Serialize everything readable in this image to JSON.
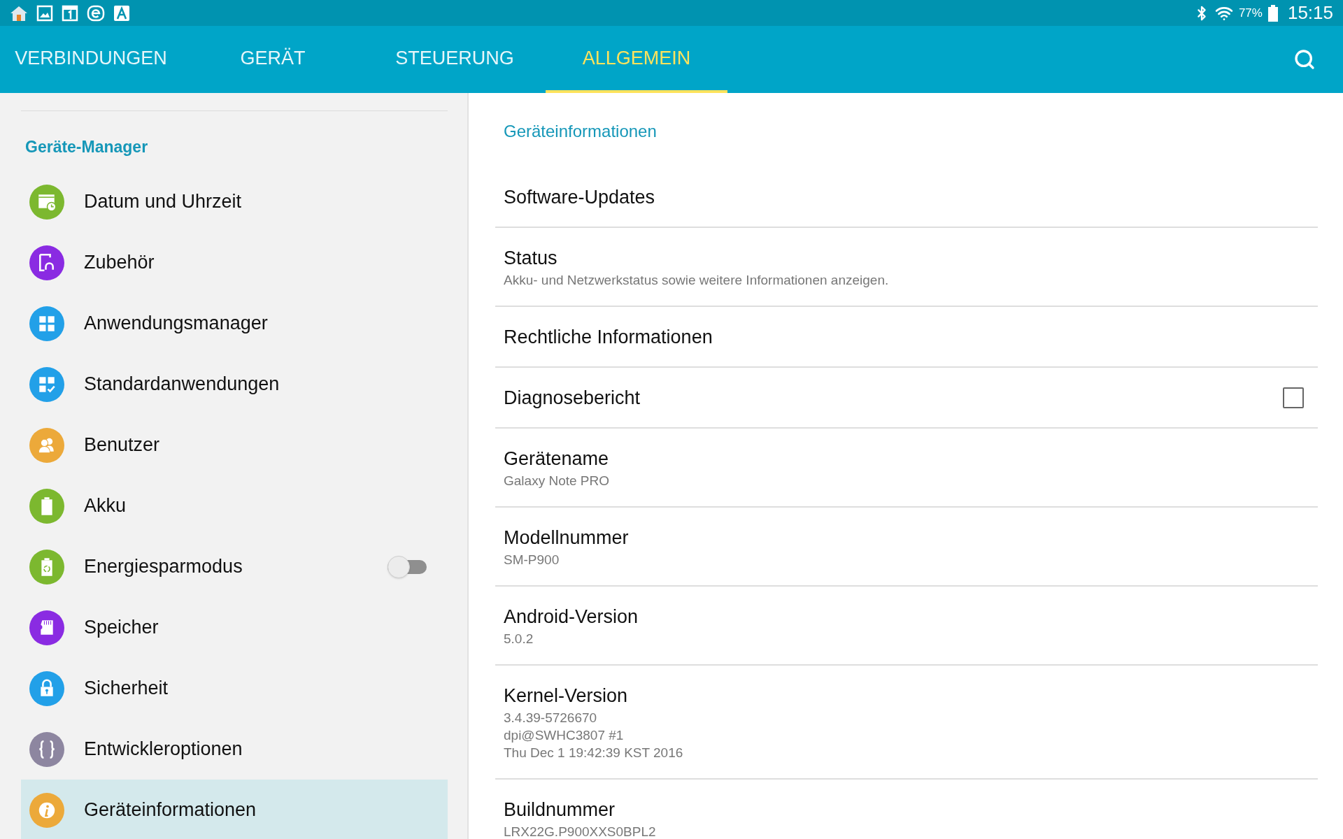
{
  "status_bar": {
    "battery_text": "77%",
    "time": "15:15"
  },
  "tabs": [
    {
      "label": "VERBINDUNGEN",
      "selected": false
    },
    {
      "label": "GERÄT",
      "selected": false
    },
    {
      "label": "STEUERUNG",
      "selected": false
    },
    {
      "label": "ALLGEMEIN",
      "selected": true
    }
  ],
  "sidebar": {
    "header": "Geräte-Manager",
    "items": [
      {
        "label": "Datum und Uhrzeit",
        "color": "#7cb82f",
        "selected": false
      },
      {
        "label": "Zubehör",
        "color": "#8a2be2",
        "selected": false
      },
      {
        "label": "Anwendungsmanager",
        "color": "#22a0e8",
        "selected": false
      },
      {
        "label": "Standardanwendungen",
        "color": "#22a0e8",
        "selected": false
      },
      {
        "label": "Benutzer",
        "color": "#eca93a",
        "selected": false
      },
      {
        "label": "Akku",
        "color": "#7cb82f",
        "selected": false
      },
      {
        "label": "Energiesparmodus",
        "color": "#7cb82f",
        "selected": false,
        "toggle": {
          "on": false
        }
      },
      {
        "label": "Speicher",
        "color": "#8a2be2",
        "selected": false
      },
      {
        "label": "Sicherheit",
        "color": "#22a0e8",
        "selected": false
      },
      {
        "label": "Entwickleroptionen",
        "color": "#8d86a0",
        "selected": false
      },
      {
        "label": "Geräteinformationen",
        "color": "#eca93a",
        "selected": true
      }
    ]
  },
  "content": {
    "heading": "Geräteinformationen",
    "rows": [
      {
        "title": "Software-Updates"
      },
      {
        "title": "Status",
        "details": [
          "Akku- und Netzwerkstatus sowie weitere Informationen anzeigen."
        ]
      },
      {
        "title": "Rechtliche Informationen"
      },
      {
        "title": "Diagnosebericht",
        "checkbox": {
          "checked": false
        }
      },
      {
        "title": "Gerätename",
        "details": [
          "Galaxy Note PRO"
        ]
      },
      {
        "title": "Modellnummer",
        "details": [
          "SM-P900"
        ]
      },
      {
        "title": "Android-Version",
        "details": [
          "5.0.2"
        ]
      },
      {
        "title": "Kernel-Version",
        "details": [
          "3.4.39-5726670",
          "dpi@SWHC3807 #1",
          "Thu Dec 1 19:42:39 KST 2016"
        ]
      },
      {
        "title": "Buildnummer",
        "details": [
          "LRX22G.P900XXS0BPL2"
        ]
      }
    ]
  }
}
